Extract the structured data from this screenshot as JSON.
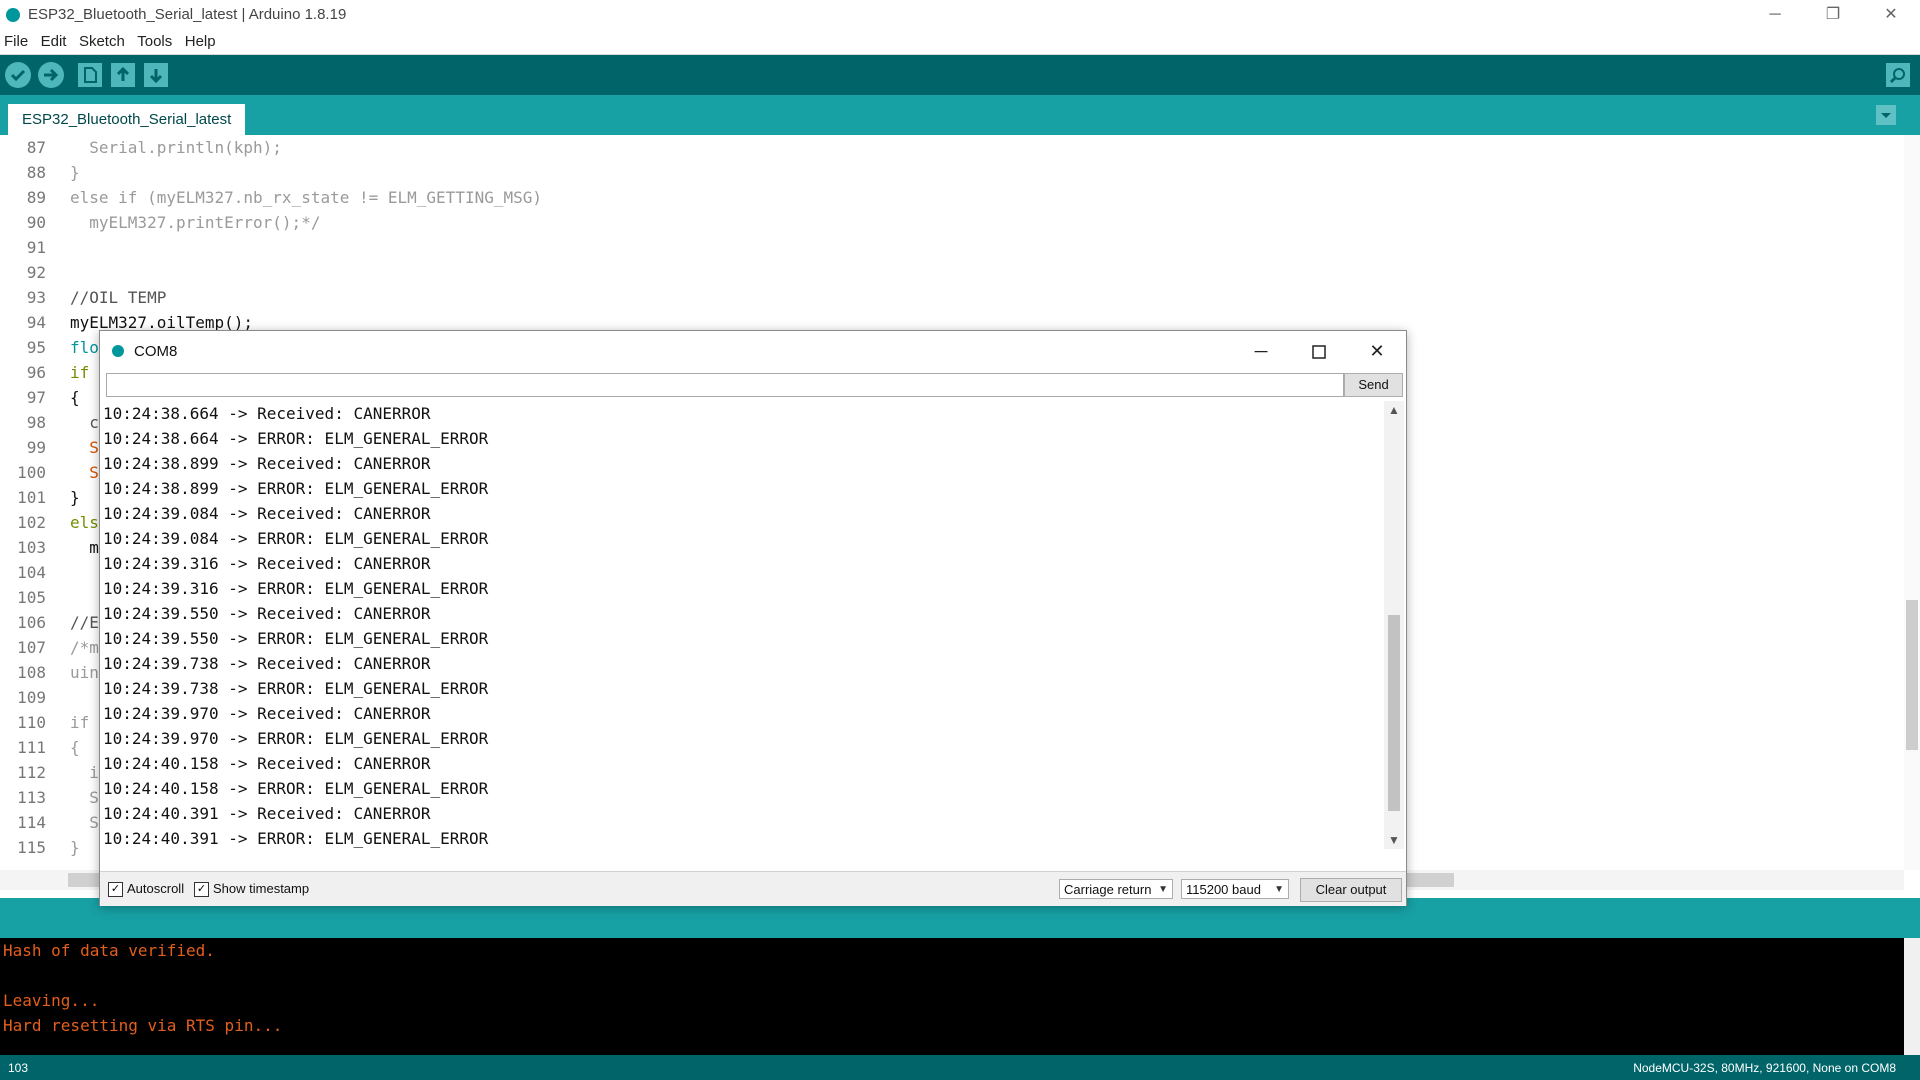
{
  "window": {
    "title": "ESP32_Bluetooth_Serial_latest | Arduino 1.8.19",
    "minimize": "─",
    "restore": "❐",
    "close": "✕"
  },
  "menu": [
    "File",
    "Edit",
    "Sketch",
    "Tools",
    "Help"
  ],
  "tab": {
    "label": "ESP32_Bluetooth_Serial_latest"
  },
  "editor": {
    "lines": [
      {
        "num": "87",
        "text": "  Serial.println(kph);",
        "color": "#9a9a9a"
      },
      {
        "num": "88",
        "text": "}",
        "color": "#9a9a9a"
      },
      {
        "num": "89",
        "text": "else if (myELM327.nb_rx_state != ELM_GETTING_MSG)",
        "color": "#9a9a9a"
      },
      {
        "num": "90",
        "text": "  myELM327.printError();*/",
        "color": "#9a9a9a"
      },
      {
        "num": "91",
        "text": "",
        "color": "#000000"
      },
      {
        "num": "92",
        "text": "",
        "color": "#000000"
      },
      {
        "num": "93",
        "text": "//OIL TEMP",
        "color": "#555555"
      },
      {
        "num": "94",
        "text": "myELM327.oilTemp();",
        "color": "#111111"
      },
      {
        "num": "95",
        "text": "flo",
        "color": "#00979c"
      },
      {
        "num": "96",
        "text": "if",
        "color": "#728e00"
      },
      {
        "num": "97",
        "text": "{",
        "color": "#111111"
      },
      {
        "num": "98",
        "text": "  c",
        "color": "#555555"
      },
      {
        "num": "99",
        "text": "  S",
        "color": "#d35400"
      },
      {
        "num": "100",
        "text": "  S",
        "color": "#d35400"
      },
      {
        "num": "101",
        "text": "}",
        "color": "#111111"
      },
      {
        "num": "102",
        "text": "els",
        "color": "#728e00"
      },
      {
        "num": "103",
        "text": "  m",
        "color": "#111111"
      },
      {
        "num": "104",
        "text": "",
        "color": "#000000"
      },
      {
        "num": "105",
        "text": "",
        "color": "#000000"
      },
      {
        "num": "106",
        "text": "//E",
        "color": "#555555"
      },
      {
        "num": "107",
        "text": "/*m",
        "color": "#9a9a9a"
      },
      {
        "num": "108",
        "text": "uin",
        "color": "#9a9a9a"
      },
      {
        "num": "109",
        "text": "",
        "color": "#000000"
      },
      {
        "num": "110",
        "text": "if",
        "color": "#9a9a9a"
      },
      {
        "num": "111",
        "text": "{",
        "color": "#9a9a9a"
      },
      {
        "num": "112",
        "text": "  i",
        "color": "#9a9a9a"
      },
      {
        "num": "113",
        "text": "  S",
        "color": "#9a9a9a"
      },
      {
        "num": "114",
        "text": "  S",
        "color": "#9a9a9a"
      },
      {
        "num": "115",
        "text": "}",
        "color": "#9a9a9a"
      }
    ]
  },
  "console": {
    "lines": [
      "Hash of data verified.",
      "",
      "Leaving...",
      "Hard resetting via RTS pin..."
    ]
  },
  "footer": {
    "line": "103",
    "board": "NodeMCU-32S, 80MHz, 921600, None on COM8"
  },
  "serial_monitor": {
    "title": "COM8",
    "input_value": "",
    "send_label": "Send",
    "output": [
      "10:24:38.664 -> Received: CANERROR",
      "10:24:38.664 -> ERROR: ELM_GENERAL_ERROR",
      "10:24:38.899 -> Received: CANERROR",
      "10:24:38.899 -> ERROR: ELM_GENERAL_ERROR",
      "10:24:39.084 -> Received: CANERROR",
      "10:24:39.084 -> ERROR: ELM_GENERAL_ERROR",
      "10:24:39.316 -> Received: CANERROR",
      "10:24:39.316 -> ERROR: ELM_GENERAL_ERROR",
      "10:24:39.550 -> Received: CANERROR",
      "10:24:39.550 -> ERROR: ELM_GENERAL_ERROR",
      "10:24:39.738 -> Received: CANERROR",
      "10:24:39.738 -> ERROR: ELM_GENERAL_ERROR",
      "10:24:39.970 -> Received: CANERROR",
      "10:24:39.970 -> ERROR: ELM_GENERAL_ERROR",
      "10:24:40.158 -> Received: CANERROR",
      "10:24:40.158 -> ERROR: ELM_GENERAL_ERROR",
      "10:24:40.391 -> Received: CANERROR",
      "10:24:40.391 -> ERROR: ELM_GENERAL_ERROR"
    ],
    "autoscroll_label": "Autoscroll",
    "autoscroll_checked": true,
    "timestamp_label": "Show timestamp",
    "timestamp_checked": true,
    "line_ending": "Carriage return",
    "baud": "115200 baud",
    "clear_label": "Clear output"
  },
  "colors": {
    "toolbar": "#006468",
    "tabbar": "#17a1a5",
    "console_text": "#e35f1d"
  },
  "icons": {
    "verify": "check-icon",
    "upload": "arrow-right-icon",
    "new": "new-file-icon",
    "open": "open-arrow-up-icon",
    "save": "save-arrow-down-icon",
    "serial_monitor": "magnifier-icon"
  }
}
